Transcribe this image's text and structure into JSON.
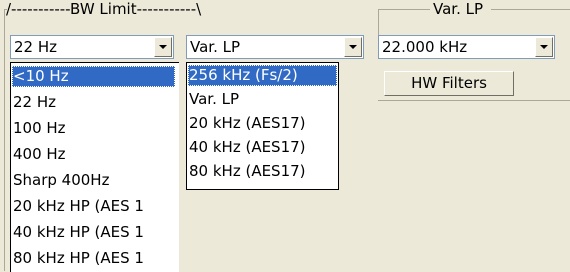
{
  "bw_limit": {
    "header": "/-----------BW Limit-----------\\",
    "combo1": {
      "value": "22 Hz",
      "options": [
        "<10 Hz",
        "22 Hz",
        "100 Hz",
        "400 Hz",
        "Sharp 400Hz",
        "20 kHz HP (AES 1",
        "40 kHz HP (AES 1",
        "80 kHz HP (AES 1"
      ],
      "selected_index": 0
    },
    "combo2": {
      "value": "Var. LP",
      "options": [
        "256 kHz (Fs/2)",
        "Var. LP",
        "20 kHz (AES17)",
        "40 kHz (AES17)",
        "80 kHz (AES17)"
      ],
      "selected_index": 0
    }
  },
  "var_lp": {
    "header": "Var. LP",
    "combo": {
      "value": "22.000 kHz"
    },
    "hw_filters_button": "HW Filters"
  },
  "colors": {
    "background": "#ece9d8",
    "selection": "#316ac5",
    "combo_border": "#7f9db9"
  },
  "icons": {
    "combo_arrow": "chevron-down-icon"
  }
}
